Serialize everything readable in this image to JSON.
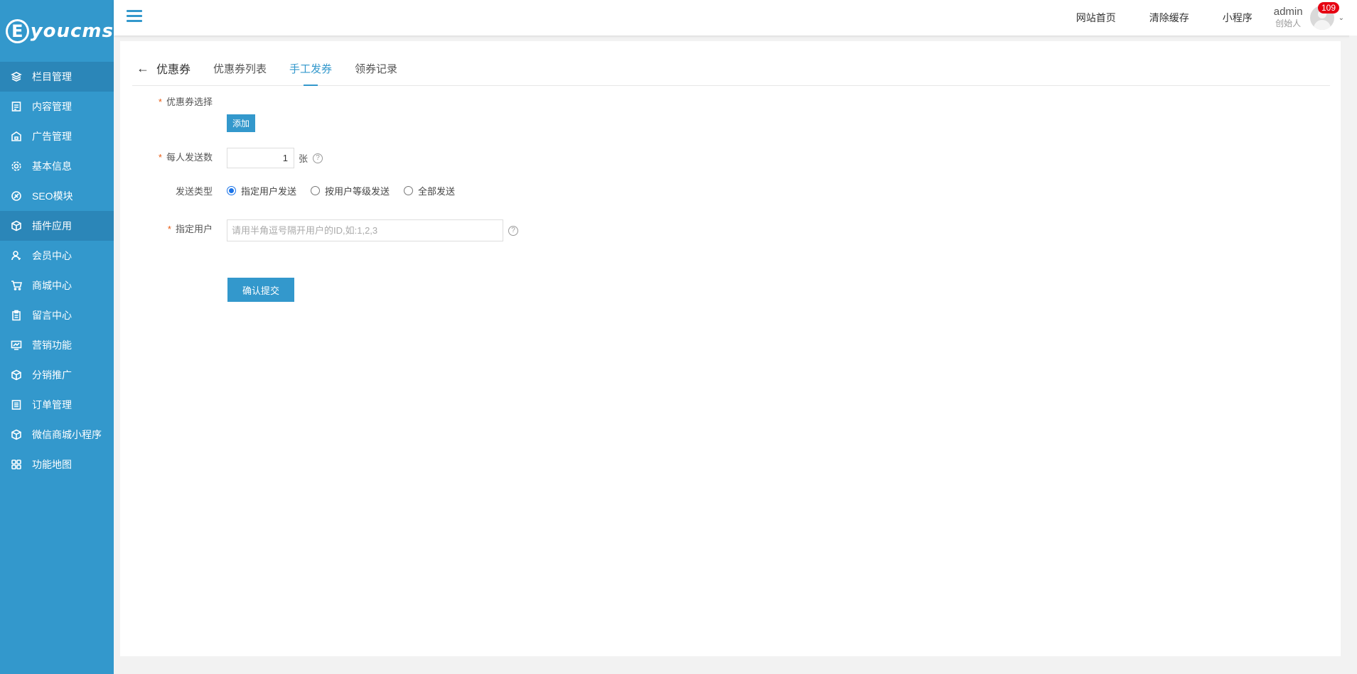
{
  "brand": {
    "badge": "E",
    "name": "youcms"
  },
  "sidebar": {
    "items": [
      {
        "label": "栏目管理",
        "icon": "layers-icon"
      },
      {
        "label": "内容管理",
        "icon": "document-icon"
      },
      {
        "label": "广告管理",
        "icon": "ad-icon"
      },
      {
        "label": "基本信息",
        "icon": "gear-icon"
      },
      {
        "label": "SEO模块",
        "icon": "seo-icon"
      },
      {
        "label": "插件应用",
        "icon": "cube-icon"
      },
      {
        "label": "会员中心",
        "icon": "user-icon"
      },
      {
        "label": "商城中心",
        "icon": "cart-icon"
      },
      {
        "label": "留言中心",
        "icon": "clipboard-icon"
      },
      {
        "label": "营销功能",
        "icon": "monitor-icon"
      },
      {
        "label": "分销推广",
        "icon": "cube-icon"
      },
      {
        "label": "订单管理",
        "icon": "list-icon"
      },
      {
        "label": "微信商城小程序",
        "icon": "cube-icon"
      },
      {
        "label": "功能地图",
        "icon": "grid-icon"
      }
    ]
  },
  "header": {
    "links": [
      "网站首页",
      "清除缓存",
      "小程序"
    ],
    "user": {
      "name": "admin",
      "role": "创始人",
      "badge": "109"
    }
  },
  "tabs": {
    "back_title": "优惠券",
    "items": [
      "优惠券列表",
      "手工发券",
      "领券记录"
    ]
  },
  "form": {
    "coupon_select_label": "优惠券选择",
    "add_button": "添加",
    "per_person_label": "每人发送数",
    "per_person_value": "1",
    "per_person_unit": "张",
    "send_type_label": "发送类型",
    "send_type_options": [
      "指定用户发送",
      "按用户等级发送",
      "全部发送"
    ],
    "user_label": "指定用户",
    "user_placeholder": "请用半角逗号隔开用户的ID,如:1,2,3",
    "submit": "确认提交"
  },
  "colors": {
    "primary": "#3398cc",
    "required": "#e85b13",
    "badge": "#e60012"
  }
}
